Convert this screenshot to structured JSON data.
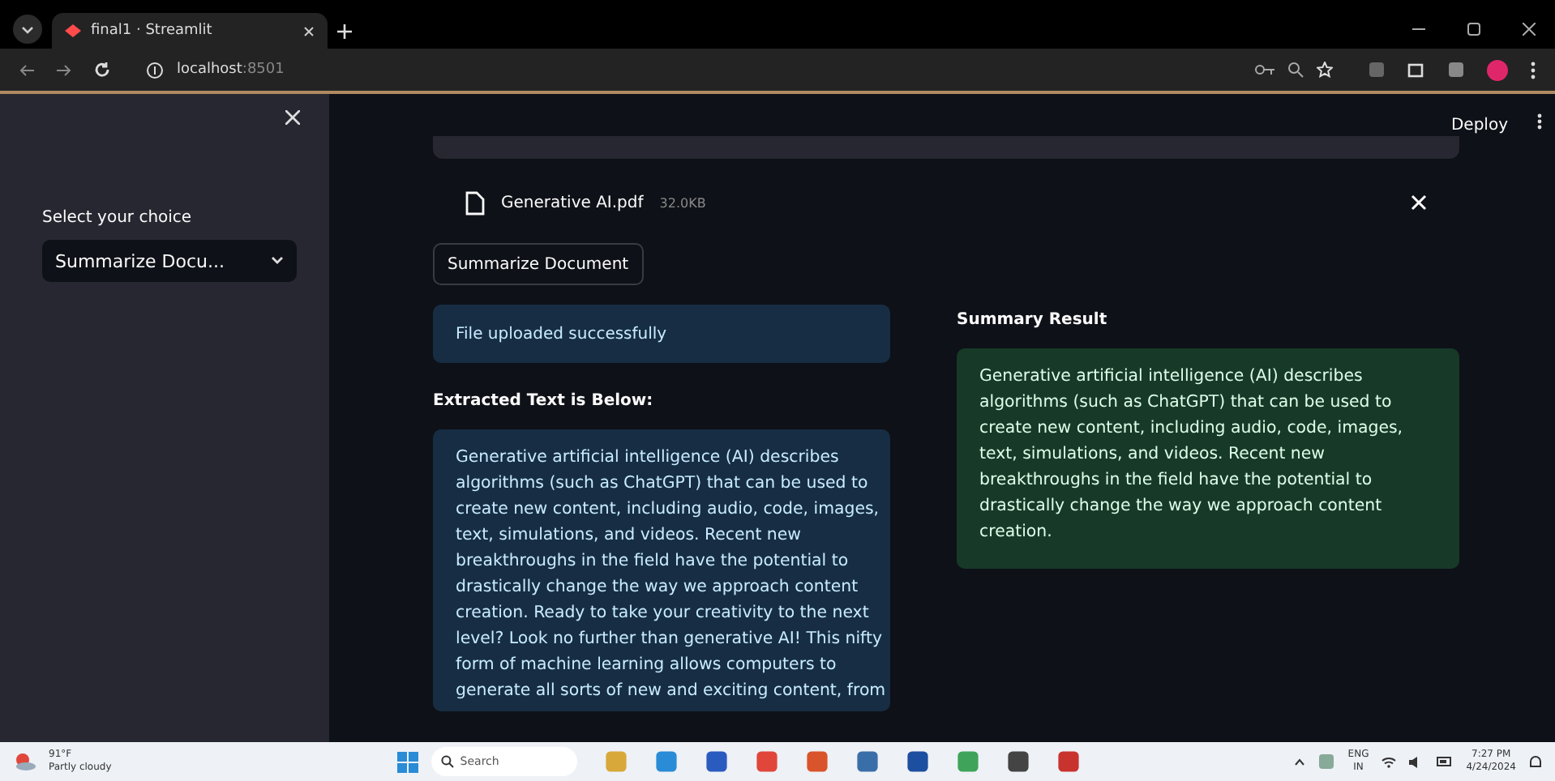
{
  "browser": {
    "tab_title": "final1 · Streamlit",
    "url_host": "localhost",
    "url_port": ":8501"
  },
  "sidebar": {
    "label": "Select your choice",
    "select_value": "Summarize Docu..."
  },
  "header": {
    "deploy": "Deploy"
  },
  "upload": {
    "file_name": "Generative AI.pdf",
    "file_size": "32.0KB"
  },
  "action_button": "Summarize Document",
  "info_message": "File uploaded successfully",
  "extracted": {
    "heading": "Extracted Text is Below:",
    "lines": [
      "Generative artificial intelligence (AI) describes",
      "algorithms (such as ChatGPT) that can be used to",
      "create new content, including audio, code, images,",
      "text, simulations, and videos. Recent new",
      "breakthroughs in the field have the potential to",
      "drastically change the way we approach content",
      "creation. Ready to take your creativity to the next",
      "level? Look no further than generative AI! This nifty",
      "form of machine learning allows computers to",
      "generate all sorts of new and exciting content, from"
    ]
  },
  "summary": {
    "heading": "Summary Result",
    "lines": [
      "Generative artificial intelligence (AI) describes",
      "algorithms (such as ChatGPT) that can be used to",
      "create new content, including audio, code, images,",
      "text, simulations, and videos. Recent new",
      "breakthroughs in the field have the potential to",
      "drastically change the way we approach content",
      "creation."
    ]
  },
  "taskbar": {
    "temperature": "91°F",
    "weather": "Partly cloudy",
    "search_placeholder": "Search",
    "language": "ENG",
    "region": "IN",
    "time": "7:27 PM",
    "date": "4/24/2024"
  }
}
